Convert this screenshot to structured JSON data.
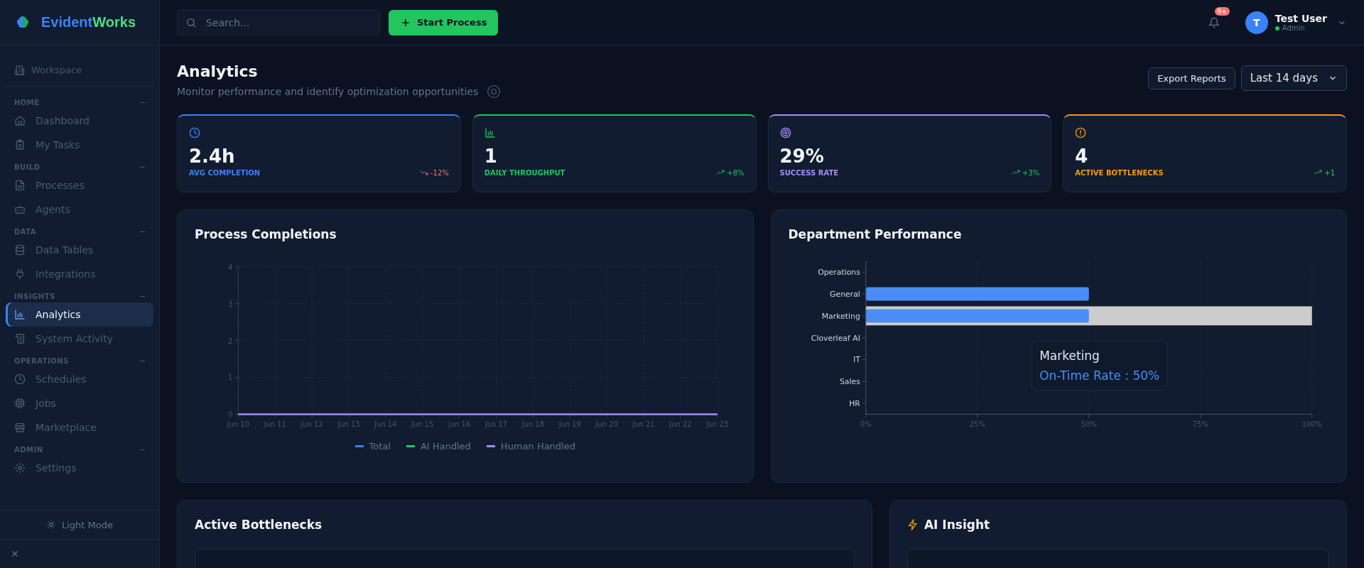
{
  "brand": {
    "name_part1": "Evident",
    "name_part2": "Works"
  },
  "workspace": {
    "label": "Workspace"
  },
  "sidebar": {
    "sections": [
      {
        "title": "HOME",
        "items": [
          {
            "label": "Dashboard",
            "kind": "home",
            "selected": false
          },
          {
            "label": "My Tasks",
            "kind": "clipboard",
            "selected": false
          }
        ]
      },
      {
        "title": "BUILD",
        "items": [
          {
            "label": "Processes",
            "kind": "file",
            "selected": false
          },
          {
            "label": "Agents",
            "kind": "bot",
            "selected": false
          }
        ]
      },
      {
        "title": "DATA",
        "items": [
          {
            "label": "Data Tables",
            "kind": "database",
            "selected": false
          },
          {
            "label": "Integrations",
            "kind": "plug",
            "selected": false
          }
        ]
      },
      {
        "title": "INSIGHTS",
        "items": [
          {
            "label": "Analytics",
            "kind": "chart",
            "selected": true
          },
          {
            "label": "System Activity",
            "kind": "scroll",
            "selected": false
          }
        ]
      },
      {
        "title": "OPERATIONS",
        "items": [
          {
            "label": "Schedules",
            "kind": "clock",
            "selected": false
          },
          {
            "label": "Jobs",
            "kind": "cpu",
            "selected": false
          },
          {
            "label": "Marketplace",
            "kind": "store",
            "selected": false
          }
        ]
      },
      {
        "title": "ADMIN",
        "items": [
          {
            "label": "Settings",
            "kind": "gear",
            "selected": false
          }
        ]
      }
    ],
    "theme_toggle": "Light Mode"
  },
  "topbar": {
    "search": {
      "placeholder": "Search..."
    },
    "start_button": "Start Process",
    "notifications": {
      "badge": "9+"
    },
    "user": {
      "initial": "T",
      "name": "Test User",
      "role": "Admin",
      "online": true
    }
  },
  "header": {
    "title": "Analytics",
    "subtitle": "Monitor performance and identify optimization opportunities",
    "export_button": "Export Reports",
    "range_select": {
      "value": "Last 14 days"
    }
  },
  "stats": [
    {
      "kind": "clock",
      "value": "2.4h",
      "label": "AVG COMPLETION",
      "trend": {
        "text": "-12%",
        "kind": "down"
      },
      "color": "#3b82f6"
    },
    {
      "kind": "chart",
      "value": "1",
      "label": "DAILY THROUGHPUT",
      "trend": {
        "text": "+8%",
        "kind": "up"
      },
      "color": "#22c55e"
    },
    {
      "kind": "target",
      "value": "29%",
      "label": "SUCCESS RATE",
      "trend": {
        "text": "+3%",
        "kind": "up"
      },
      "color": "#a78bfa"
    },
    {
      "kind": "alert",
      "value": "4",
      "label": "ACTIVE BOTTLENECKS",
      "trend": {
        "text": "+1",
        "kind": "up"
      },
      "color": "#f59e0b"
    }
  ],
  "completions": {
    "title": "Process Completions",
    "chart_data": {
      "type": "line",
      "categories": [
        "Jun 10",
        "Jun 11",
        "Jun 12",
        "Jun 13",
        "Jun 14",
        "Jun 15",
        "Jun 16",
        "Jun 17",
        "Jun 18",
        "Jun 19",
        "Jun 20",
        "Jun 21",
        "Jun 22",
        "Jun 23"
      ],
      "ylim": [
        0,
        4
      ],
      "yticks": [
        0,
        1,
        2,
        3,
        4
      ],
      "grid": true,
      "series": [
        {
          "name": "Total",
          "color": "#3b82f6",
          "values": [
            null,
            null,
            null,
            null,
            null,
            null,
            null,
            null,
            null,
            null,
            null,
            null,
            null,
            null
          ]
        },
        {
          "name": "AI Handled",
          "color": "#22c55e",
          "values": [
            null,
            null,
            null,
            null,
            null,
            null,
            null,
            null,
            null,
            null,
            null,
            null,
            null,
            null
          ]
        },
        {
          "name": "Human Handled",
          "color": "#a78bfa",
          "values": [
            0,
            0,
            0,
            0,
            0,
            0,
            0,
            0,
            0,
            0,
            0,
            0,
            0,
            0
          ]
        }
      ]
    }
  },
  "departments": {
    "title": "Department Performance",
    "chart_data": {
      "type": "bar",
      "orientation": "horizontal",
      "categories": [
        "Operations",
        "General",
        "Marketing",
        "Cloverleaf AI",
        "IT",
        "Sales",
        "HR"
      ],
      "values": [
        0,
        50,
        50,
        0,
        0,
        0,
        0
      ],
      "xlim": [
        0,
        100
      ],
      "grid": true,
      "xticks": [
        {
          "value": 0,
          "label": "0%"
        },
        {
          "value": 25,
          "label": "25%"
        },
        {
          "value": 50,
          "label": "50%"
        },
        {
          "value": 75,
          "label": "75%"
        },
        {
          "value": 100,
          "label": "100%"
        }
      ]
    },
    "bar_states": [
      {
        "hovered": false
      },
      {
        "hovered": false
      },
      {
        "hovered": true
      },
      {
        "hovered": false
      },
      {
        "hovered": false
      },
      {
        "hovered": false
      },
      {
        "hovered": false
      }
    ],
    "tooltip": {
      "title": "Marketing",
      "text": "On-Time Rate : 50%"
    }
  },
  "bottlenecks": {
    "title": "Active Bottlenecks"
  },
  "insight": {
    "title": "AI Insight"
  }
}
